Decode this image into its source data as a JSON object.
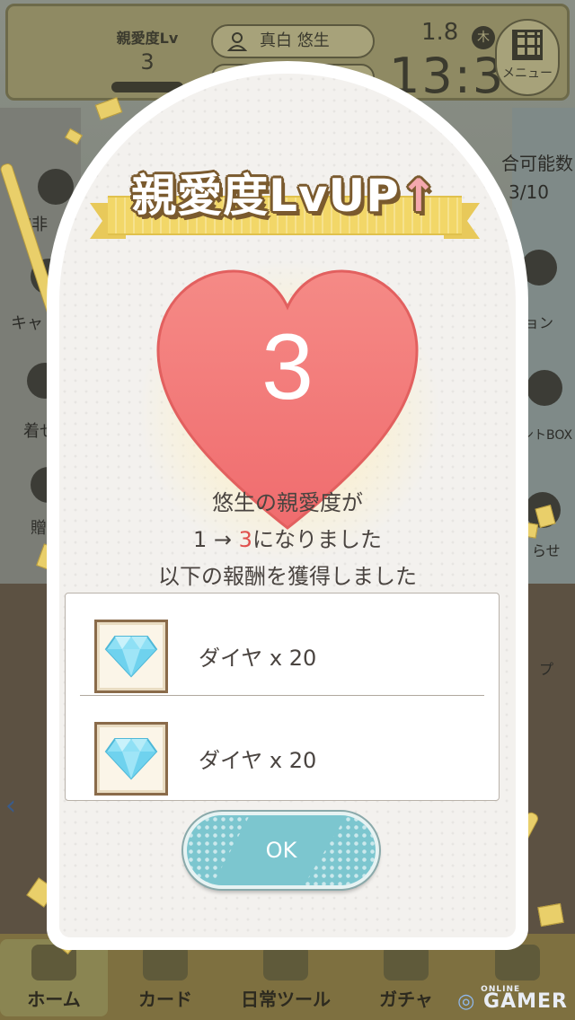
{
  "status_bar": {
    "affection_label": "親愛度Lv",
    "affection_level": "3",
    "character_name": "真白 悠生",
    "date": "1.8",
    "day_of_week": "木",
    "time": "13:3",
    "menu_label": "メニュー"
  },
  "side_menu": {
    "left": [
      "U非",
      "キャ",
      "着せ",
      "贈"
    ],
    "right": [
      "合可能数",
      "3/10",
      "ョン",
      "ントBOX",
      "らせ",
      "プ"
    ]
  },
  "dialog": {
    "title": "親愛度LvUP",
    "title_arrow": "↑",
    "level": "3",
    "message_line1": "悠生の親愛度が",
    "message_from": "1 → ",
    "message_to": "3",
    "message_line2_suffix": "になりました",
    "message_line3": "以下の報酬を獲得しました",
    "rewards": [
      {
        "icon": "diamond-icon",
        "label": "ダイヤ x 20"
      },
      {
        "icon": "diamond-icon",
        "label": "ダイヤ x 20"
      }
    ],
    "ok_label": "OK"
  },
  "bottom_nav": {
    "items": [
      {
        "label": "ホーム"
      },
      {
        "label": "カード"
      },
      {
        "label": "日常ツール"
      },
      {
        "label": "ガチャ"
      },
      {
        "label": ""
      }
    ]
  },
  "watermark": {
    "top": "ONLINE",
    "main": "GAMER"
  },
  "colors": {
    "heart": "#f47a7a",
    "highlight": "#e0504d",
    "ok_button": "#7cc6cf",
    "banner": "#f2d768"
  }
}
